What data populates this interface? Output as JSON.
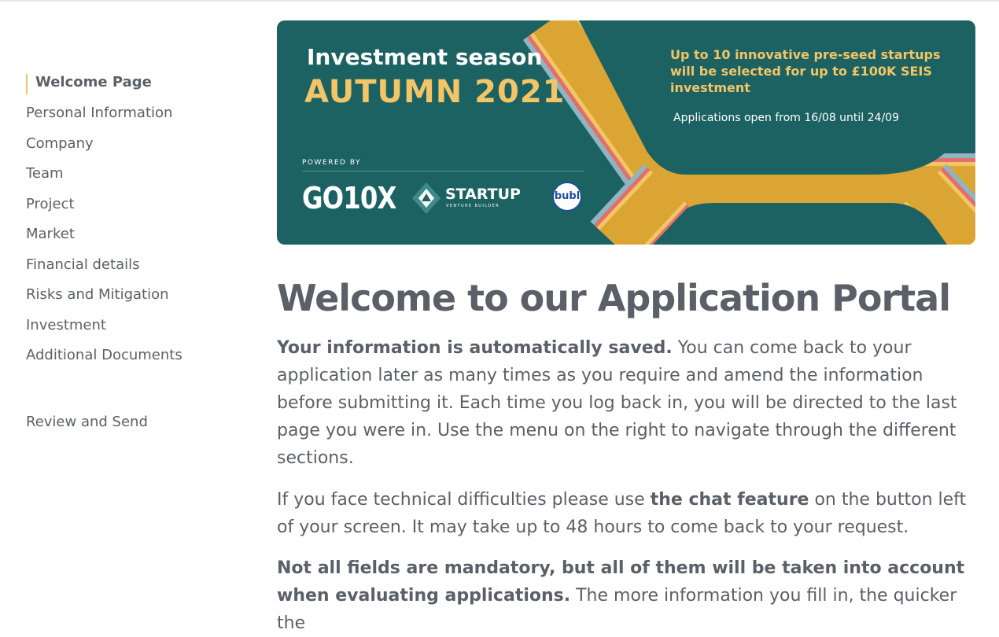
{
  "sidebar": {
    "items": [
      {
        "label": "Welcome Page",
        "active": true
      },
      {
        "label": "Personal Information"
      },
      {
        "label": "Company"
      },
      {
        "label": "Team"
      },
      {
        "label": "Project"
      },
      {
        "label": "Market"
      },
      {
        "label": "Financial details"
      },
      {
        "label": "Risks and Mitigation"
      },
      {
        "label": "Investment"
      },
      {
        "label": "Additional Documents"
      }
    ],
    "review": "Review and Send",
    "active_color": "#f1c75a"
  },
  "banner": {
    "title": "Investment season",
    "season": "AUTUMN 2021",
    "tagline": "Up to 10 innovative pre-seed startups will be selected for up to £100K SEIS investment",
    "dates": "Applications open from 16/08 until 24/09",
    "powered_by": "POWERED BY",
    "logos": {
      "go10x": "GO10X",
      "startup": "STARTUP",
      "startup_sub": "VENTURE BUILDER",
      "bubl": "bubl"
    },
    "colors": {
      "background": "#1c6262",
      "accent": "#f3c566",
      "stripe_gold": "#dba534",
      "stripe_red": "#e0706a",
      "stripe_blue": "#8fb5c4"
    }
  },
  "main": {
    "title": "Welcome to our Application Portal",
    "p1_bold": "Your information is automatically saved.",
    "p1_rest": " You can come back to your application later as many times as you require and amend the information before submitting it. Each time you log back in, you will be directed to the last page you were in. Use the menu on the right to navigate through the different sections.",
    "p2_start": "If you face technical difficulties please use ",
    "p2_bold": "the chat feature",
    "p2_end": " on the button left of your screen. It may take up to 48 hours to come back to your request.",
    "p3_bold": "Not all fields are mandatory, but all of them will be taken into account when evaluating applications.",
    "p3_rest": " The more information you fill in, the quicker the"
  }
}
